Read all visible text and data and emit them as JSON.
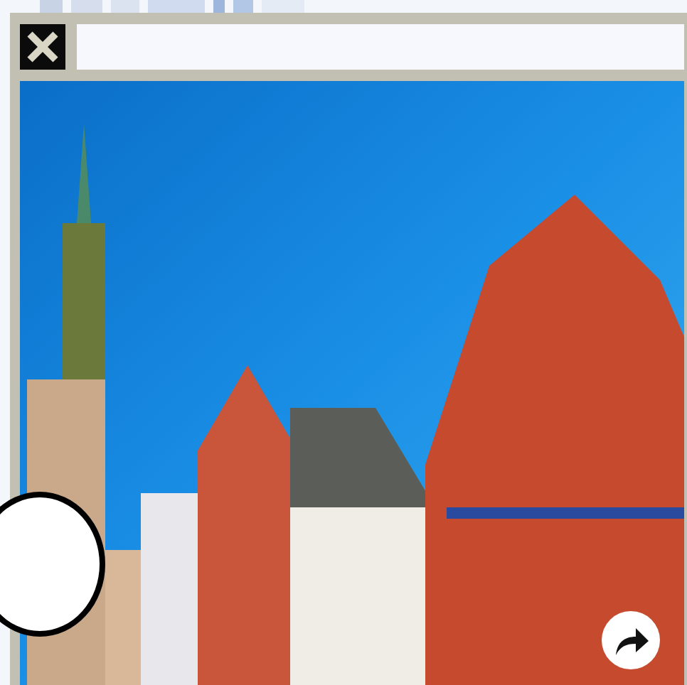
{
  "lightbox": {
    "photo": {
      "kind": "photo"
    },
    "controls": [
      {
        "kind": "close"
      },
      {
        "kind": "blank-circle"
      },
      {
        "kind": "share"
      }
    ]
  }
}
